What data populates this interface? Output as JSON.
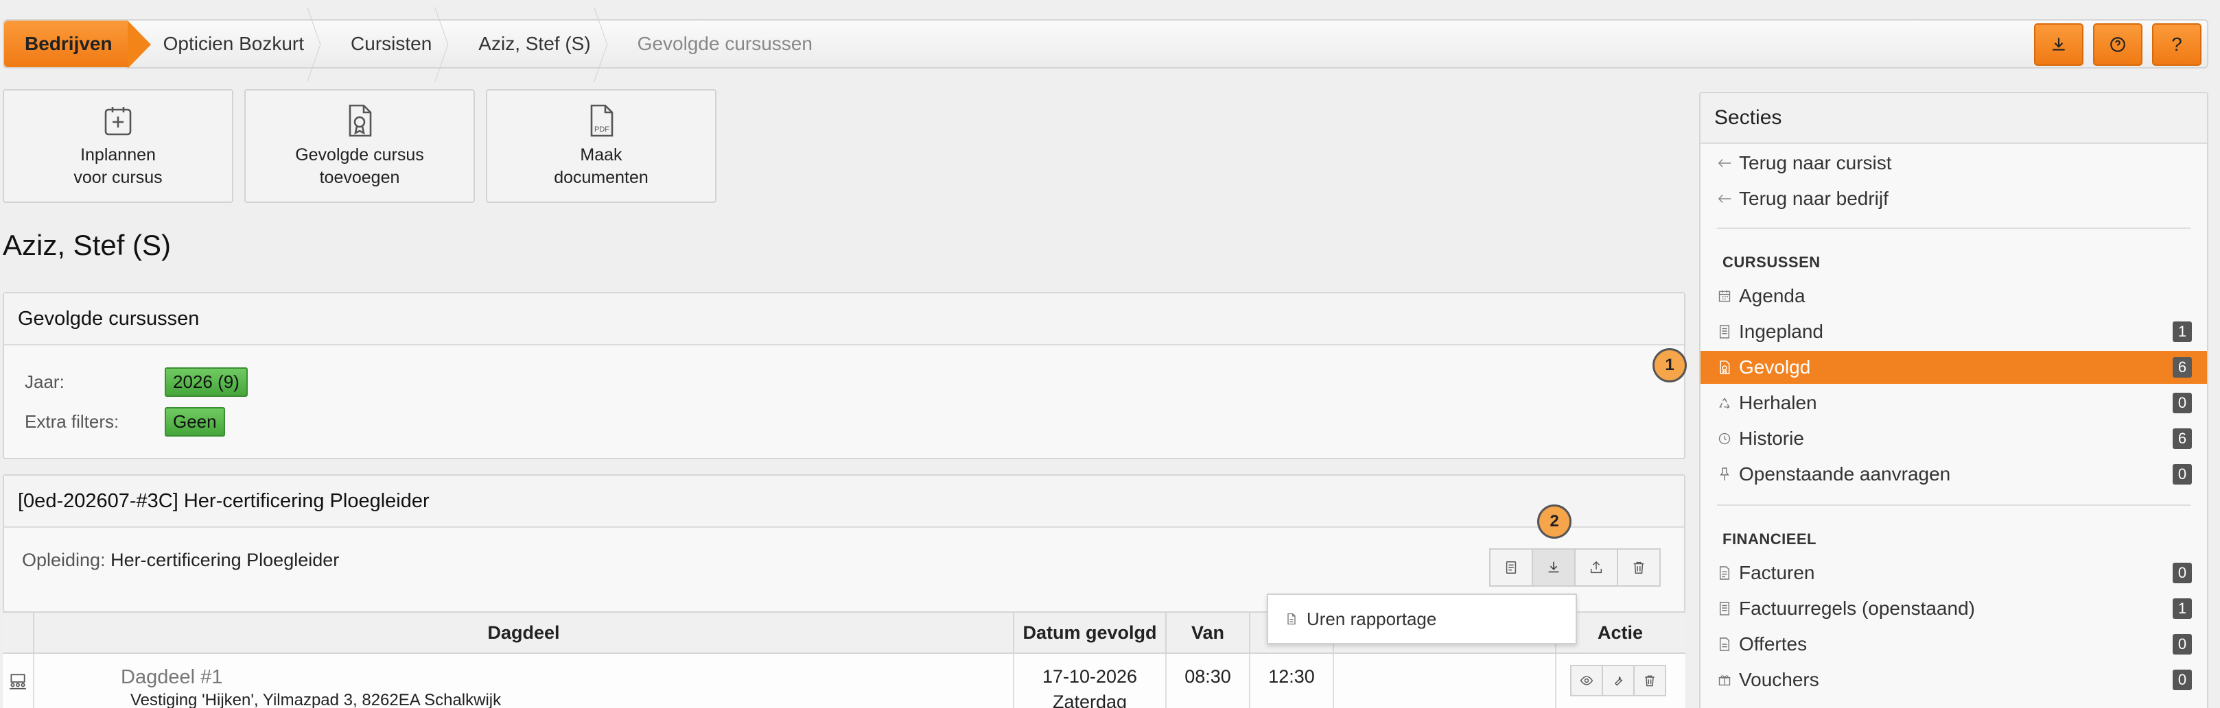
{
  "breadcrumb": {
    "items": [
      "Bedrijven",
      "Opticien Bozkurt",
      "Cursisten",
      "Aziz, Stef (S)",
      "Gevolgde cursussen"
    ]
  },
  "top_actions": [
    {
      "icon": "download-icon"
    },
    {
      "icon": "help-circle-icon"
    },
    {
      "label": "?"
    }
  ],
  "tiles": [
    {
      "line1": "Inplannen",
      "line2": "voor cursus",
      "icon": "calendar-plus-icon"
    },
    {
      "line1": "Gevolgde cursus",
      "line2": "toevoegen",
      "icon": "certificate-icon"
    },
    {
      "line1": "Maak",
      "line2": "documenten",
      "icon": "pdf-icon",
      "icon_text": "PDF"
    }
  ],
  "page_title": "Aziz, Stef (S)",
  "filters_panel": {
    "title": "Gevolgde cursussen",
    "year_label": "Jaar:",
    "year_value": "2026 (9)",
    "extra_label": "Extra filters:",
    "extra_value": "Geen"
  },
  "markers": [
    "1",
    "2"
  ],
  "course_panel": {
    "title": "[0ed-202607-#3C] Her-certificering Ploegleider",
    "opleiding_label": "Opleiding:",
    "opleiding_value": "Her-certificering Ploegleider",
    "dropdown_item": "Uren rapportage"
  },
  "table": {
    "headers": [
      "Dagdeel",
      "Datum gevolgd",
      "Van",
      "Actie"
    ],
    "rows": [
      {
        "name": "Dagdeel #1",
        "location": "Vestiging 'Hijken', Yilmazpad 3, 8262EA Schalkwijk",
        "date": "17-10-2026",
        "day": "Zaterdag",
        "from": "08:30",
        "to": "12:30"
      }
    ]
  },
  "sidebar": {
    "title": "Secties",
    "back_links": [
      "Terug naar cursist",
      "Terug naar bedrijf"
    ],
    "sections": [
      {
        "heading": "CURSUSSEN",
        "items": [
          {
            "label": "Agenda",
            "icon": "calendar-icon"
          },
          {
            "label": "Ingepland",
            "icon": "document-icon",
            "count": "1"
          },
          {
            "label": "Gevolgd",
            "icon": "certificate-icon",
            "count": "6",
            "active": true
          },
          {
            "label": "Herhalen",
            "icon": "recycle-icon",
            "count": "0"
          },
          {
            "label": "Historie",
            "icon": "clock-icon",
            "count": "6"
          },
          {
            "label": "Openstaande aanvragen",
            "icon": "pin-icon",
            "count": "0"
          }
        ]
      },
      {
        "heading": "FINANCIEEL",
        "items": [
          {
            "label": "Facturen",
            "icon": "invoice-icon",
            "count": "0"
          },
          {
            "label": "Factuurregels (openstaand)",
            "icon": "document-icon",
            "count": "1"
          },
          {
            "label": "Offertes",
            "icon": "quote-icon",
            "count": "0"
          },
          {
            "label": "Vouchers",
            "icon": "voucher-icon",
            "count": "0"
          }
        ]
      }
    ]
  },
  "colors": {
    "accent": "#f28220",
    "badge_green": "#4fae44",
    "count_bg": "#555555"
  }
}
